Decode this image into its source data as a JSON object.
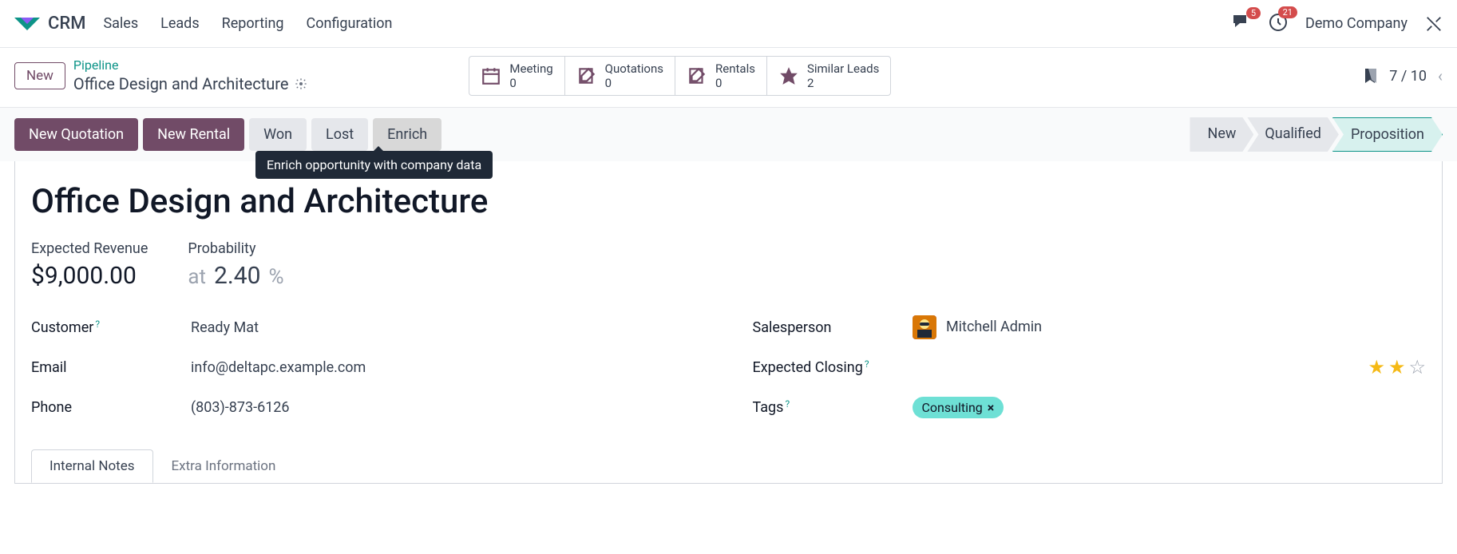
{
  "app_name": "CRM",
  "nav": [
    "Sales",
    "Leads",
    "Reporting",
    "Configuration"
  ],
  "badges": {
    "messages": "5",
    "activities": "21"
  },
  "company": "Demo Company",
  "new_btn": "New",
  "breadcrumb": {
    "link": "Pipeline",
    "current": "Office Design and Architecture"
  },
  "stats": [
    {
      "label": "Meeting",
      "val": "0"
    },
    {
      "label": "Quotations",
      "val": "0"
    },
    {
      "label": "Rentals",
      "val": "0"
    },
    {
      "label": "Similar Leads",
      "val": "2"
    }
  ],
  "pager": "7 / 10",
  "actions": {
    "new_quotation": "New Quotation",
    "new_rental": "New Rental",
    "won": "Won",
    "lost": "Lost",
    "enrich": "Enrich"
  },
  "tooltip": "Enrich opportunity with company data",
  "stages": [
    "New",
    "Qualified",
    "Proposition"
  ],
  "title": "Office Design and Architecture",
  "expected_revenue": {
    "label": "Expected Revenue",
    "value": "$9,000.00"
  },
  "probability": {
    "label": "Probability",
    "at": "at",
    "value": "2.40",
    "pct": "%"
  },
  "fields": {
    "customer": {
      "label": "Customer",
      "value": "Ready Mat"
    },
    "email": {
      "label": "Email",
      "value": "info@deltapc.example.com"
    },
    "phone": {
      "label": "Phone",
      "value": "(803)-873-6126"
    },
    "salesperson": {
      "label": "Salesperson",
      "value": "Mitchell Admin"
    },
    "expected_closing": {
      "label": "Expected Closing",
      "value": ""
    },
    "tags": {
      "label": "Tags",
      "value": "Consulting"
    }
  },
  "tabs": [
    "Internal Notes",
    "Extra Information"
  ]
}
